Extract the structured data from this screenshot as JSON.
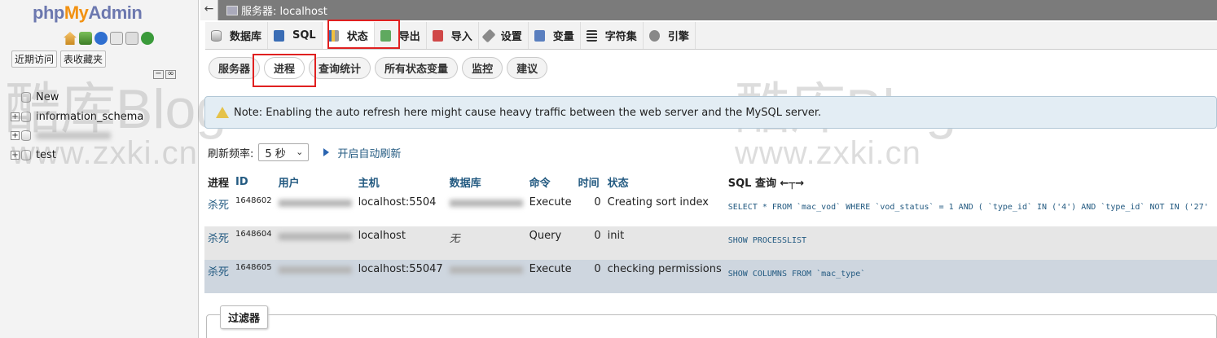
{
  "nav": {
    "logo": {
      "php": "php",
      "my": "My",
      "admin": "Admin"
    },
    "tabs": [
      "近期访问",
      "表收藏夹"
    ],
    "tree": [
      {
        "label": "New"
      },
      {
        "label": "information_schema"
      },
      {
        "label": ""
      },
      {
        "label": "test"
      }
    ]
  },
  "server_bar": {
    "collapse": "←",
    "label": "服务器: localhost"
  },
  "topmenu": [
    {
      "label": "数据库",
      "icon": "database-icon"
    },
    {
      "label": "SQL",
      "icon": "sql-icon"
    },
    {
      "label": "状态",
      "icon": "status-icon"
    },
    {
      "label": "导出",
      "icon": "export-icon"
    },
    {
      "label": "导入",
      "icon": "import-icon"
    },
    {
      "label": "设置",
      "icon": "settings-icon"
    },
    {
      "label": "变量",
      "icon": "variables-icon"
    },
    {
      "label": "字符集",
      "icon": "charsets-icon"
    },
    {
      "label": "引擎",
      "icon": "engines-icon"
    }
  ],
  "submenu": [
    "服务器",
    "进程",
    "查询统计",
    "所有状态变量",
    "监控",
    "建议"
  ],
  "watermark": {
    "logo": "酷库Blog",
    "url": "www.zxki.cn"
  },
  "notice": "Note: Enabling the auto refresh here might cause heavy traffic between the web server and the MySQL server.",
  "refresh": {
    "label": "刷新频率:",
    "value": "5 秒",
    "auto_label": "开启自动刷新"
  },
  "table": {
    "headers": [
      "进程",
      "ID",
      "用户",
      "主机",
      "数据库",
      "命令",
      "时间",
      "状态",
      "SQL 查询 ←┬→"
    ],
    "rows": [
      {
        "kill": "杀死",
        "id": "1648602",
        "host": "localhost:5504",
        "command": "Execute",
        "time": "0",
        "state": "Creating sort index",
        "sql": "SELECT * FROM `mac_vod` WHERE `vod_status` = 1 AND ( `type_id` IN ('4') AND `type_id` NOT IN ('27'"
      },
      {
        "kill": "杀死",
        "id": "1648604",
        "host": "localhost",
        "db": "无",
        "command": "Query",
        "time": "0",
        "state": "init",
        "sql": "SHOW PROCESSLIST"
      },
      {
        "kill": "杀死",
        "id": "1648605",
        "host": "localhost:55047",
        "command": "Execute",
        "time": "0",
        "state": "checking permissions",
        "sql": "SHOW COLUMNS FROM `mac_type`"
      }
    ]
  },
  "filter": {
    "legend": "过滤器"
  },
  "colors": {
    "highlight": "#e02020",
    "link": "#235a81",
    "server_bar": "#7b7b7b"
  }
}
